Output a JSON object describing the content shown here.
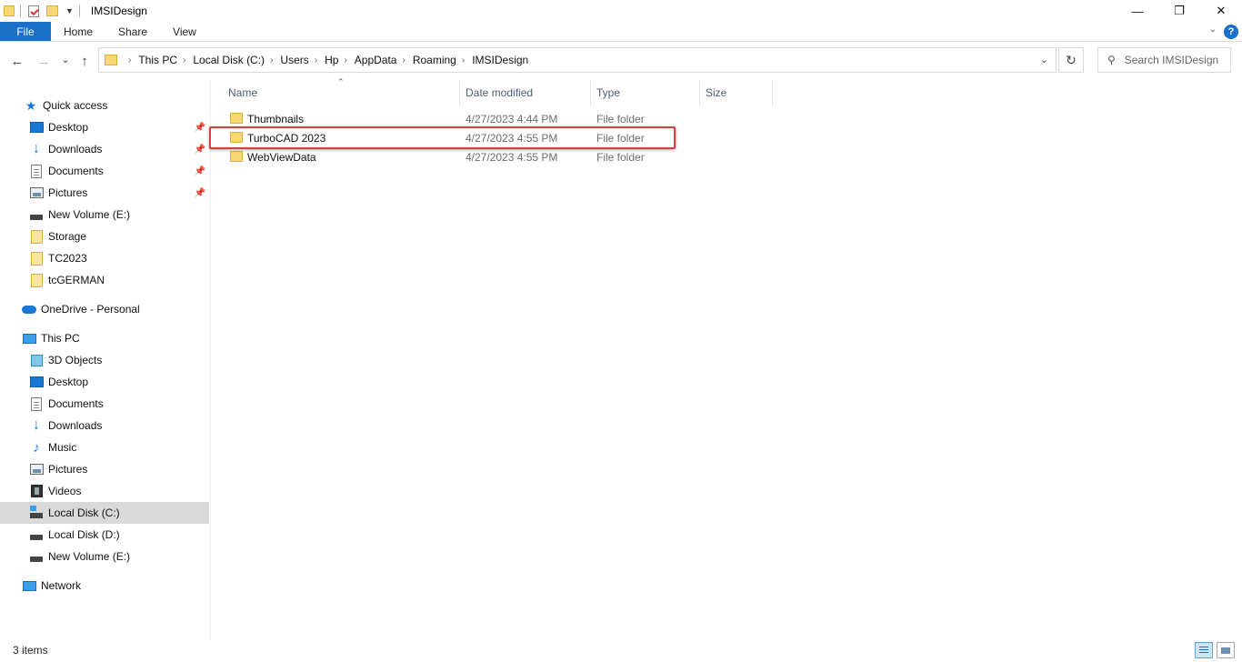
{
  "window": {
    "title": "IMSIDesign",
    "controls": {
      "minimize": "—",
      "maximize": "❐",
      "close": "✕"
    }
  },
  "ribbon": {
    "tabs": [
      "File",
      "Home",
      "Share",
      "View"
    ],
    "help": "?"
  },
  "nav": {
    "back": "←",
    "forward": "→",
    "recent": "⌄",
    "up": "↑",
    "breadcrumb": [
      "This PC",
      "Local Disk (C:)",
      "Users",
      "Hp",
      "AppData",
      "Roaming",
      "IMSIDesign"
    ],
    "refresh": "↻",
    "search_placeholder": "Search IMSIDesign"
  },
  "sidebar": {
    "quick_access": {
      "label": "Quick access",
      "items": [
        {
          "label": "Desktop",
          "icon": "desktop-icon",
          "pinned": true
        },
        {
          "label": "Downloads",
          "icon": "downloads-icon",
          "pinned": true
        },
        {
          "label": "Documents",
          "icon": "documents-icon",
          "pinned": true
        },
        {
          "label": "Pictures",
          "icon": "pictures-icon",
          "pinned": true
        },
        {
          "label": "New Volume (E:)",
          "icon": "drive-icon",
          "pinned": false
        },
        {
          "label": "Storage",
          "icon": "folder-icon",
          "pinned": false
        },
        {
          "label": "TC2023",
          "icon": "folder-icon",
          "pinned": false
        },
        {
          "label": "tcGERMAN",
          "icon": "folder-icon",
          "pinned": false
        }
      ]
    },
    "onedrive": {
      "label": "OneDrive - Personal"
    },
    "this_pc": {
      "label": "This PC",
      "items": [
        {
          "label": "3D Objects",
          "icon": "3d-objects-icon"
        },
        {
          "label": "Desktop",
          "icon": "desktop-icon"
        },
        {
          "label": "Documents",
          "icon": "documents-icon"
        },
        {
          "label": "Downloads",
          "icon": "downloads-icon"
        },
        {
          "label": "Music",
          "icon": "music-icon"
        },
        {
          "label": "Pictures",
          "icon": "pictures-icon"
        },
        {
          "label": "Videos",
          "icon": "videos-icon"
        },
        {
          "label": "Local Disk (C:)",
          "icon": "system-drive-icon",
          "selected": true
        },
        {
          "label": "Local Disk (D:)",
          "icon": "drive-icon"
        },
        {
          "label": "New Volume (E:)",
          "icon": "drive-icon"
        }
      ]
    },
    "network": {
      "label": "Network"
    }
  },
  "file_list": {
    "columns": [
      "Name",
      "Date modified",
      "Type",
      "Size"
    ],
    "rows": [
      {
        "name": "Thumbnails",
        "date": "4/27/2023 4:44 PM",
        "type": "File folder",
        "size": ""
      },
      {
        "name": "TurboCAD 2023",
        "date": "4/27/2023 4:55 PM",
        "type": "File folder",
        "size": ""
      },
      {
        "name": "WebViewData",
        "date": "4/27/2023 4:55 PM",
        "type": "File folder",
        "size": ""
      }
    ]
  },
  "status": {
    "item_count": "3 items"
  }
}
